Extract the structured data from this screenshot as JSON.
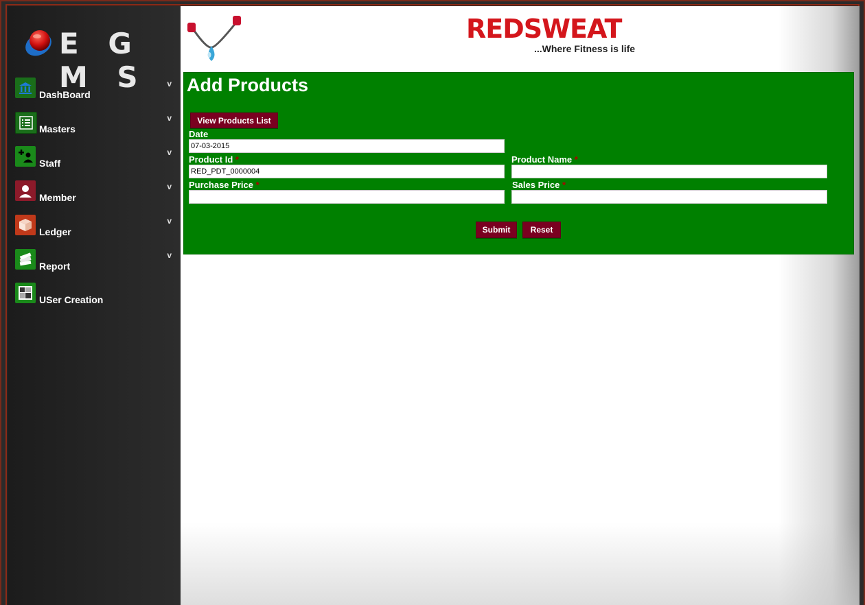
{
  "app": {
    "logo_text": "E G M S"
  },
  "sidebar": {
    "items": [
      {
        "label": "DashBoard",
        "icon": "bank-icon",
        "color": "#1a7a1a",
        "expandable": true,
        "chevron": "v"
      },
      {
        "label": "Masters",
        "icon": "list-icon",
        "color": "#1a7a1a",
        "expandable": true,
        "chevron": "v"
      },
      {
        "label": "Staff",
        "icon": "add-user-icon",
        "color": "#1a7a1a",
        "expandable": true,
        "chevron": "v"
      },
      {
        "label": "Member",
        "icon": "user-icon",
        "color": "#8c1a2a",
        "expandable": true,
        "chevron": "v"
      },
      {
        "label": "Ledger",
        "icon": "box-icon",
        "color": "#c0391a",
        "expandable": true,
        "chevron": "v"
      },
      {
        "label": "Report",
        "icon": "books-icon",
        "color": "#1a7a1a",
        "expandable": true,
        "chevron": "v"
      },
      {
        "label": "USer Creation",
        "icon": "user-creation-icon",
        "color": "#1a7a1a",
        "expandable": false,
        "chevron": ""
      }
    ]
  },
  "header": {
    "brand": "REDSWEAT",
    "tagline": "...Where Fitness is life",
    "brand_color": "#d4161c"
  },
  "form": {
    "title": "Add Products",
    "view_list_button": "View Products List",
    "date_label": "Date",
    "date_value": "07-03-2015",
    "product_id_label": "Product Id",
    "product_id_value": "RED_PDT_0000004",
    "product_name_label": "Product Name",
    "product_name_value": "",
    "purchase_price_label": "Purchase Price",
    "purchase_price_value": "",
    "sales_price_label": "Sales Price",
    "sales_price_value": "",
    "required_marker": "*",
    "submit_label": "Submit",
    "reset_label": "Reset",
    "panel_color": "#008000",
    "button_color": "#7a0020"
  }
}
